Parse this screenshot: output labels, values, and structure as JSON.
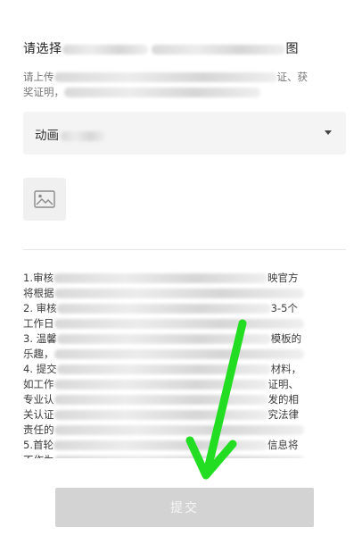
{
  "section": {
    "title_start": "请选择",
    "title_end": "图",
    "hint_line1_start": "请上传",
    "hint_line1_end": "证、获",
    "hint_line2_start": "奖证明"
  },
  "category_select": {
    "value": "动画"
  },
  "upload": {
    "icon": "image-placeholder-icon"
  },
  "notice": {
    "lines": [
      {
        "start": "1.审核",
        "end": "映官方"
      },
      {
        "start": "将根据",
        "end": ""
      },
      {
        "start": "2. 审核",
        "end": "3-5个"
      },
      {
        "start": "工作日",
        "end": ""
      },
      {
        "start": "3. 温馨",
        "end": "模板的"
      },
      {
        "start": "乐趣，",
        "end": ""
      },
      {
        "start": "4. 提交",
        "end": "材料，"
      },
      {
        "start": "如工作",
        "end": "证明、"
      },
      {
        "start": "专业认",
        "end": "发的相"
      },
      {
        "start": "关认证",
        "end": "究法律"
      },
      {
        "start": "责任的",
        "end": ""
      },
      {
        "start": "5.首轮",
        "end": "信息将"
      },
      {
        "start": "不作为",
        "end": ""
      }
    ]
  },
  "submit": {
    "label": "提交"
  },
  "colors": {
    "arrow": "#22dd22",
    "button_disabled": "#d3d3d3"
  }
}
